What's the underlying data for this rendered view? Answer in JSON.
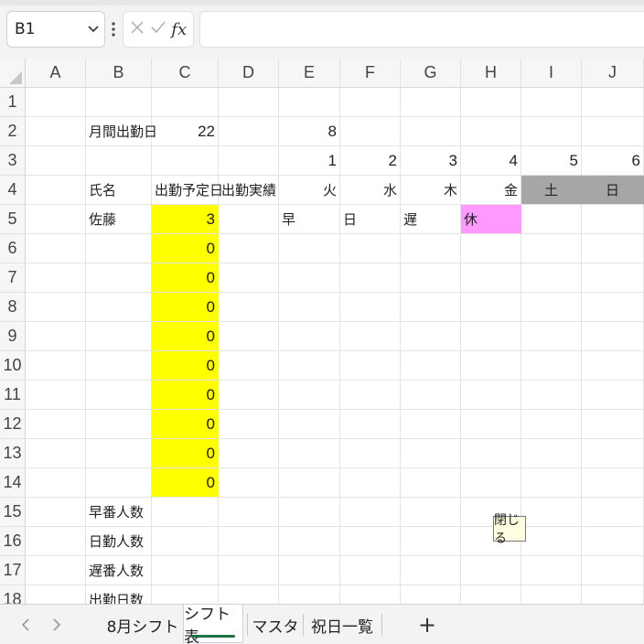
{
  "formula_bar": {
    "name_box": "B1",
    "formula": ""
  },
  "icons": {
    "dropdown": "chevron-down-icon",
    "more": "more-vertical-icon",
    "cancel": "cancel-x-icon",
    "enter": "check-icon",
    "function": "function-fx-icon",
    "scroll_left": "chevron-left-icon",
    "scroll_right": "chevron-right-icon",
    "add_sheet": "plus-icon"
  },
  "fx_label": "fx",
  "columns": [
    "A",
    "B",
    "C",
    "D",
    "E",
    "F",
    "G",
    "H",
    "I",
    "J"
  ],
  "rows": [
    "1",
    "2",
    "3",
    "4",
    "5",
    "6",
    "7",
    "8",
    "9",
    "10",
    "11",
    "12",
    "13",
    "14",
    "15",
    "16",
    "17",
    "18"
  ],
  "cells": {
    "B2": "月間出勤日",
    "C2": "22",
    "E2": "8",
    "E3": "1",
    "F3": "2",
    "G3": "3",
    "H3": "4",
    "I3": "5",
    "J3": "6",
    "B4": "氏名",
    "C4": "出勤予定日",
    "D4": "出勤実績",
    "E4": "火",
    "F4": "水",
    "G4": "木",
    "H4": "金",
    "I4": "土",
    "J4": "日",
    "B5": "佐藤",
    "C5": "3",
    "E5": "早",
    "F5": "日",
    "G5": "遅",
    "H5": "休",
    "C6": "0",
    "C7": "0",
    "C8": "0",
    "C9": "0",
    "C10": "0",
    "C11": "0",
    "C12": "0",
    "C13": "0",
    "C14": "0",
    "B15": "早番人数",
    "B16": "日勤人数",
    "B17": "遅番人数",
    "B18": "出勤日数"
  },
  "colors": {
    "yellow_fill": "#ffff00",
    "pink_fill": "#ff99ff",
    "weekend_fill": "#a6a6a6",
    "active_tab_underline": "#1f7244"
  },
  "tooltip": {
    "close_label": "閉じる"
  },
  "sheet_tabs": [
    {
      "label": "8月シフト",
      "active": false
    },
    {
      "label": "シフト表",
      "active": true
    },
    {
      "label": "マスタ",
      "active": false
    },
    {
      "label": "祝日一覧",
      "active": false
    }
  ]
}
